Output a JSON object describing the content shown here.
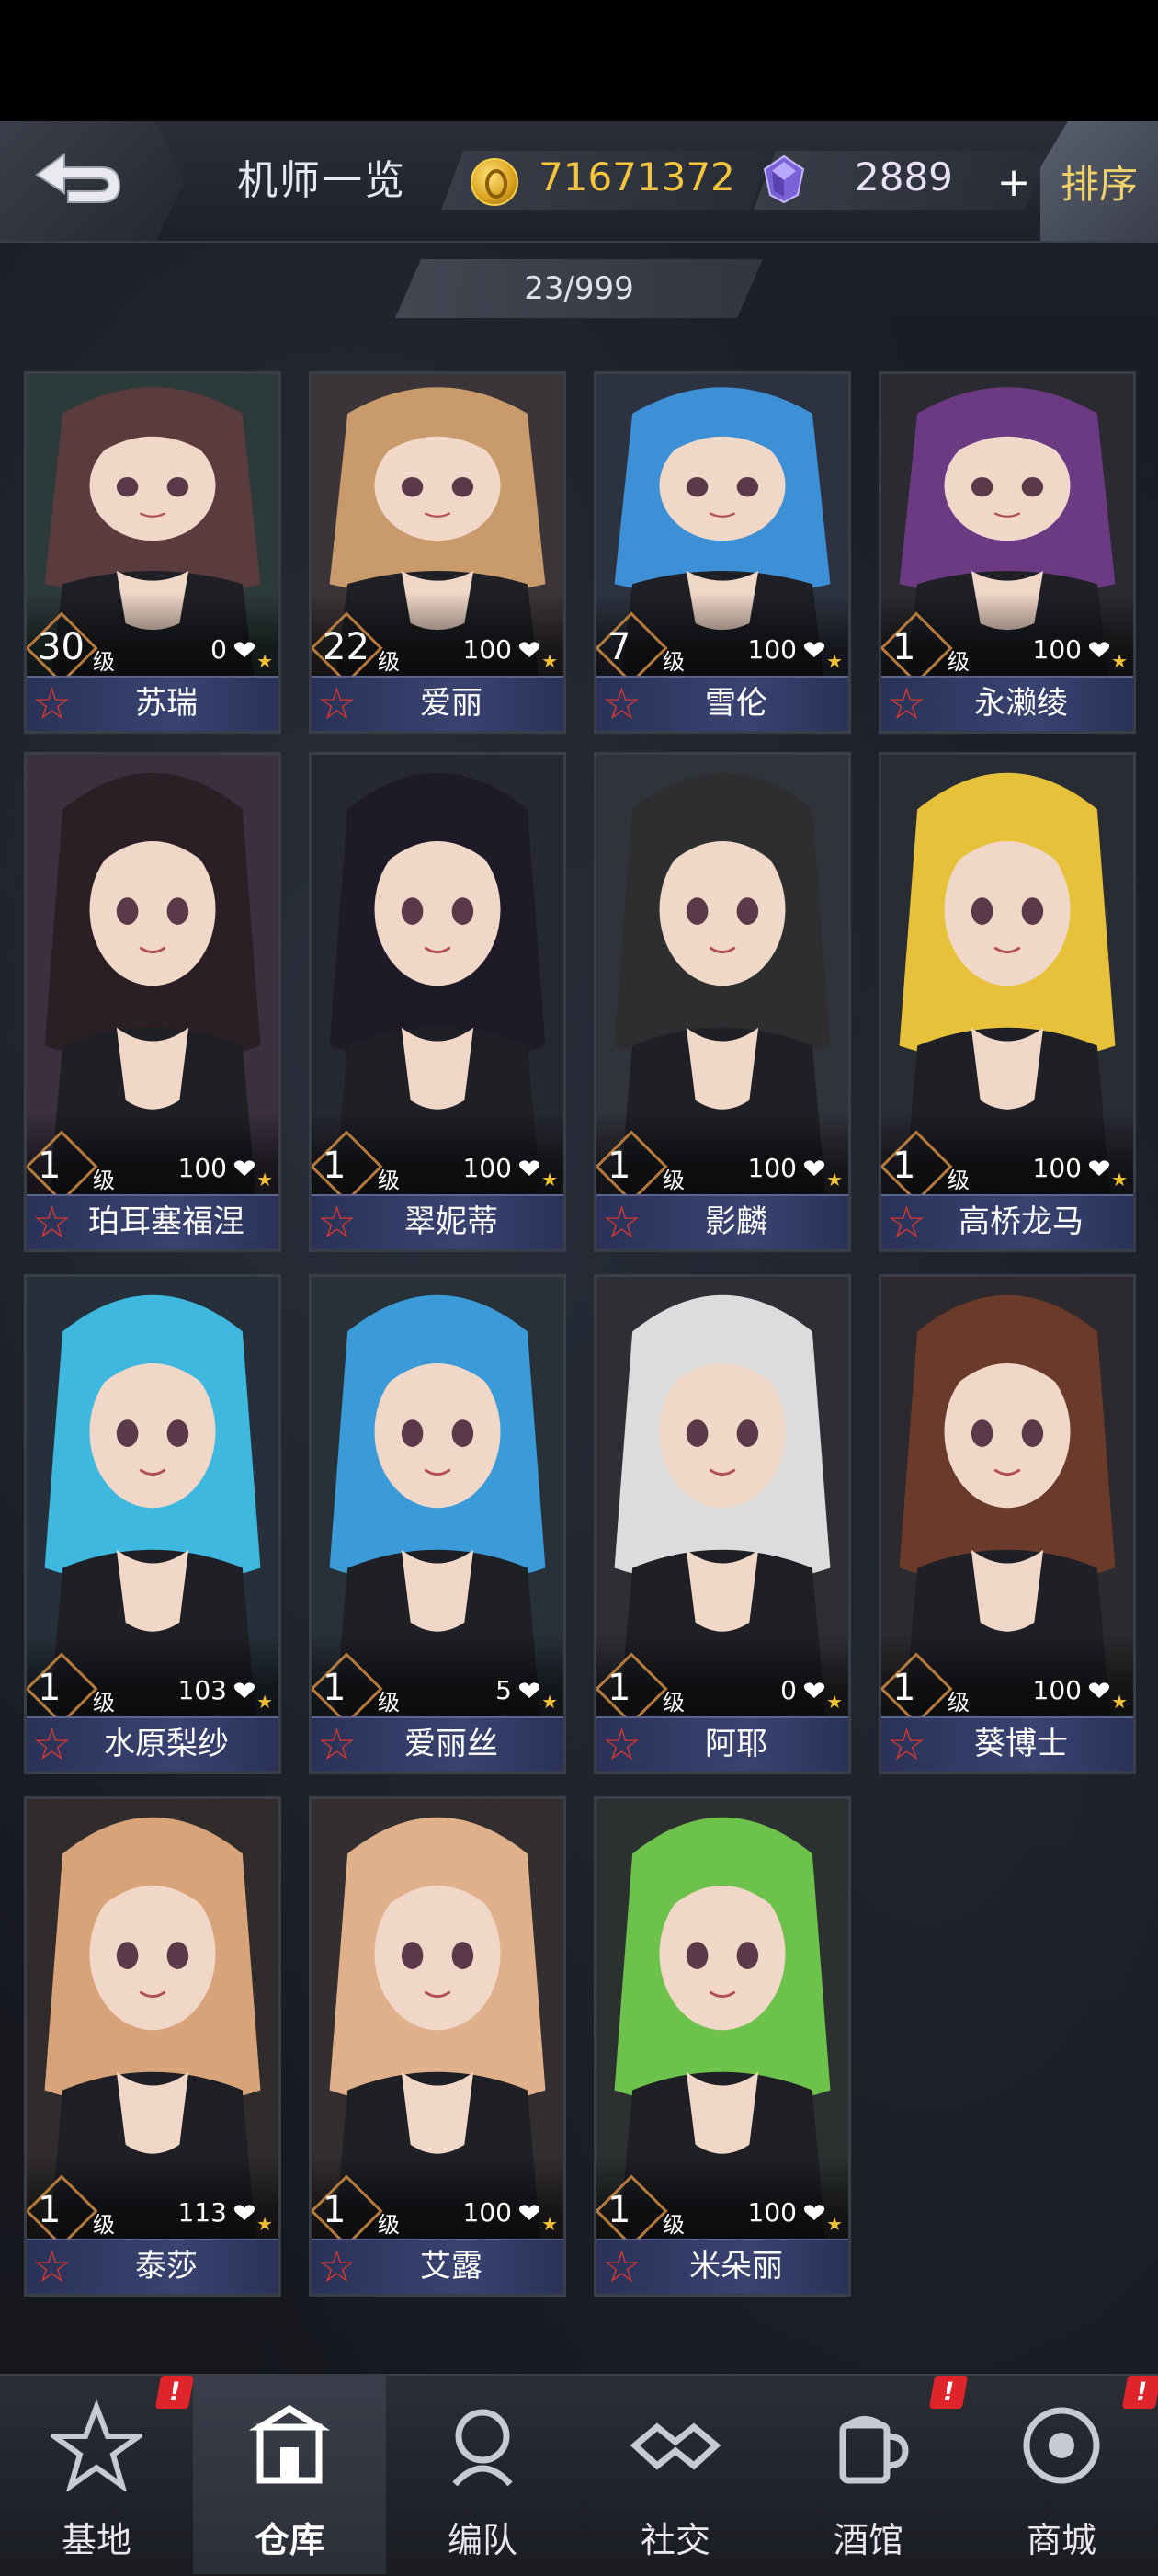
{
  "header": {
    "title": "机师一览",
    "gold": "71671372",
    "gems": "2889",
    "plus_label": "+",
    "sort_label": "排序",
    "count": "23/999"
  },
  "pilots": [
    {
      "name": "苏瑞",
      "level": "30",
      "level_unit": "级",
      "trust": "0",
      "hair": "#5a3b3e",
      "bg": "#2d3a3a"
    },
    {
      "name": "爱丽",
      "level": "22",
      "level_unit": "级",
      "trust": "100",
      "hair": "#c89a6c",
      "bg": "#3b3438"
    },
    {
      "name": "雪伦",
      "level": "7",
      "level_unit": "级",
      "trust": "100",
      "hair": "#3d8fd6",
      "bg": "#2d3240"
    },
    {
      "name": "永濑绫",
      "level": "1",
      "level_unit": "级",
      "trust": "100",
      "hair": "#6b3a82",
      "bg": "#2a2a30"
    },
    {
      "name": "珀耳塞福涅",
      "level": "1",
      "level_unit": "级",
      "trust": "100",
      "hair": "#2a1f24",
      "bg": "#3a3040"
    },
    {
      "name": "翠妮蒂",
      "level": "1",
      "level_unit": "级",
      "trust": "100",
      "hair": "#1e1a28",
      "bg": "#262830"
    },
    {
      "name": "影麟",
      "level": "1",
      "level_unit": "级",
      "trust": "100",
      "hair": "#2c2e30",
      "bg": "#30333a"
    },
    {
      "name": "高桥龙马",
      "level": "1",
      "level_unit": "级",
      "trust": "100",
      "hair": "#e8c13a",
      "bg": "#2a2c34"
    },
    {
      "name": "水原梨纱",
      "level": "1",
      "level_unit": "级",
      "trust": "103",
      "hair": "#3fb8e0",
      "bg": "#26303a"
    },
    {
      "name": "爱丽丝",
      "level": "1",
      "level_unit": "级",
      "trust": "5",
      "hair": "#3b9bd8",
      "bg": "#283038"
    },
    {
      "name": "阿耶",
      "level": "1",
      "level_unit": "级",
      "trust": "0",
      "hair": "#dcdcdc",
      "bg": "#2e2e34"
    },
    {
      "name": "葵博士",
      "level": "1",
      "level_unit": "级",
      "trust": "100",
      "hair": "#6a3a2a",
      "bg": "#2c2a2e"
    },
    {
      "name": "泰莎",
      "level": "1",
      "level_unit": "级",
      "trust": "113",
      "hair": "#d9a37a",
      "bg": "#302c2c"
    },
    {
      "name": "艾露",
      "level": "1",
      "level_unit": "级",
      "trust": "100",
      "hair": "#e0b08a",
      "bg": "#332e30"
    },
    {
      "name": "米朵丽",
      "level": "1",
      "level_unit": "级",
      "trust": "100",
      "hair": "#6cc24a",
      "bg": "#2c3030"
    }
  ],
  "nav": [
    {
      "label": "基地",
      "icon": "base-icon",
      "alert": "!"
    },
    {
      "label": "仓库",
      "icon": "warehouse-icon",
      "alert": ""
    },
    {
      "label": "编队",
      "icon": "formation-icon",
      "alert": ""
    },
    {
      "label": "社交",
      "icon": "handshake-icon",
      "alert": ""
    },
    {
      "label": "酒馆",
      "icon": "tavern-icon",
      "alert": "!"
    },
    {
      "label": "商城",
      "icon": "shop-icon",
      "alert": "!"
    }
  ],
  "colors": {
    "gold": "#f4c53d",
    "name_bar": "#2a3258",
    "star": "#d9382f",
    "alert": "#e0242b"
  }
}
